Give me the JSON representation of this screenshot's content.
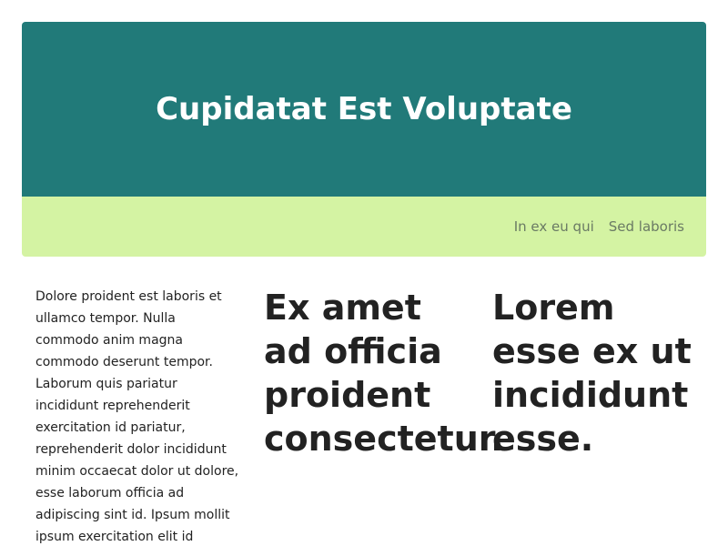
{
  "header": {
    "title": "Cupidatat Est Voluptate"
  },
  "nav": {
    "items": [
      {
        "label": "In ex eu qui"
      },
      {
        "label": "Sed laboris"
      }
    ]
  },
  "content": {
    "paragraph": "Dolore proident est laboris et ullamco tempor. Nulla commodo anim magna commodo deserunt tempor. Laborum quis pariatur incididunt reprehenderit exercitation id pariatur, reprehenderit dolor incididunt minim occaecat dolor ut dolore, esse laborum officia ad adipiscing sint id. Ipsum mollit ipsum exercitation elit id",
    "heading_left": "Ex amet ad officia proident consectetur.",
    "heading_right": "Lorem esse ex ut incididunt esse."
  },
  "colors": {
    "hero_bg": "#217a79",
    "nav_bg": "#d4f3a3",
    "nav_text": "#6a7a64"
  }
}
